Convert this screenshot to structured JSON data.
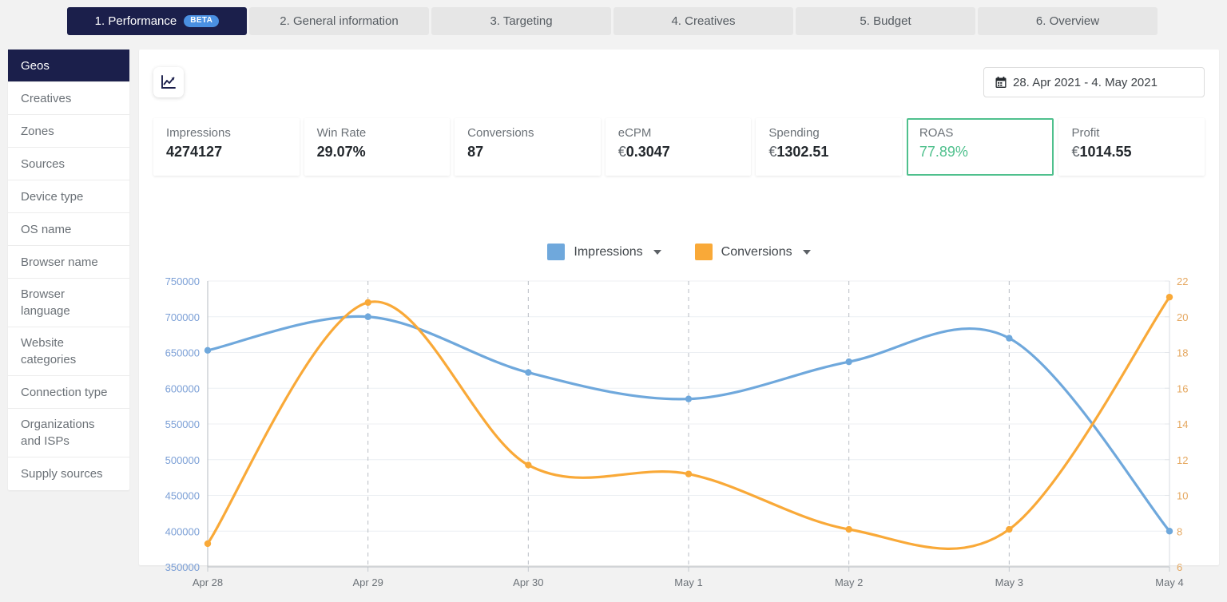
{
  "tabs": [
    {
      "label": "1. Performance",
      "badge": "BETA",
      "active": true
    },
    {
      "label": "2. General information",
      "active": false
    },
    {
      "label": "3. Targeting",
      "active": false
    },
    {
      "label": "4. Creatives",
      "active": false
    },
    {
      "label": "5. Budget",
      "active": false
    },
    {
      "label": "6. Overview",
      "active": false
    }
  ],
  "sidebar": {
    "items": [
      {
        "label": "Geos",
        "active": true
      },
      {
        "label": "Creatives",
        "active": false
      },
      {
        "label": "Zones",
        "active": false
      },
      {
        "label": "Sources",
        "active": false
      },
      {
        "label": "Device type",
        "active": false
      },
      {
        "label": "OS name",
        "active": false
      },
      {
        "label": "Browser name",
        "active": false
      },
      {
        "label": "Browser language",
        "active": false
      },
      {
        "label": "Website categories",
        "active": false
      },
      {
        "label": "Connection type",
        "active": false
      },
      {
        "label": "Organizations and ISPs",
        "active": false
      },
      {
        "label": "Supply sources",
        "active": false
      }
    ]
  },
  "toolbar": {
    "chart_icon": "line-chart-icon",
    "calendar_icon": "calendar-icon",
    "date_range": "28. Apr 2021 - 4. May 2021"
  },
  "kpis": [
    {
      "label": "Impressions",
      "value": "4274127",
      "currency": "",
      "selected": false
    },
    {
      "label": "Win Rate",
      "value": "29.07%",
      "currency": "",
      "selected": false
    },
    {
      "label": "Conversions",
      "value": "87",
      "currency": "",
      "selected": false
    },
    {
      "label": "eCPM",
      "value": "0.3047",
      "currency": "€",
      "selected": false
    },
    {
      "label": "Spending",
      "value": "1302.51",
      "currency": "€",
      "selected": false
    },
    {
      "label": "ROAS",
      "value": "77.89%",
      "currency": "",
      "selected": true
    },
    {
      "label": "Profit",
      "value": "1014.55",
      "currency": "€",
      "selected": false
    }
  ],
  "colors": {
    "impressions": "#6fa8dc",
    "conversions": "#f9a938",
    "accent_navy": "#1b1f4b",
    "accent_green": "#4fc08d",
    "beta_blue": "#4a90e2",
    "left_axis_text": "#7b9fd6",
    "right_axis_text": "#e5a861"
  },
  "chart_data": {
    "type": "line",
    "title": "",
    "xlabel": "",
    "grid": true,
    "legend_position": "top-center",
    "x": [
      "Apr 28",
      "Apr 29",
      "Apr 30",
      "May 1",
      "May 2",
      "May 3",
      "May 4"
    ],
    "axes": {
      "left": {
        "label": "Impressions",
        "ylim": [
          350000,
          750000
        ],
        "ticks": [
          350000,
          400000,
          450000,
          500000,
          550000,
          600000,
          650000,
          700000,
          750000
        ]
      },
      "right": {
        "label": "Conversions",
        "ylim": [
          6,
          22
        ],
        "ticks": [
          6,
          8,
          10,
          12,
          14,
          16,
          18,
          20,
          22
        ]
      }
    },
    "series": [
      {
        "name": "Impressions",
        "axis": "left",
        "color": "#6fa8dc",
        "values": [
          653000,
          700000,
          622000,
          585000,
          637000,
          670000,
          400000
        ]
      },
      {
        "name": "Conversions",
        "axis": "right",
        "color": "#f9a938",
        "values": [
          7.3,
          20.8,
          11.7,
          11.2,
          8.1,
          8.1,
          21.1
        ]
      }
    ]
  }
}
